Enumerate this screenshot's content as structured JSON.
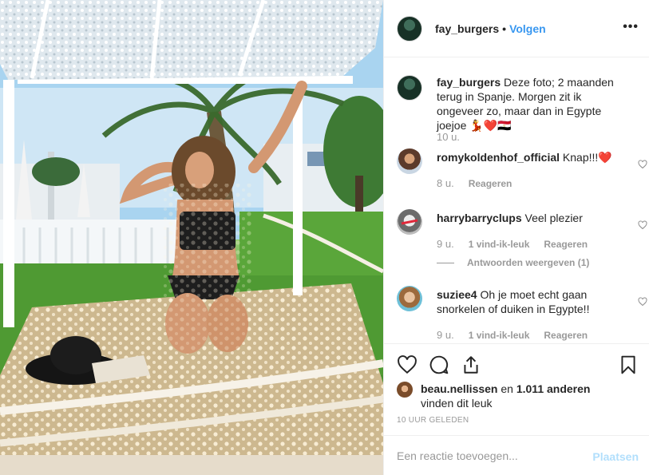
{
  "post": {
    "username": "fay_burgers",
    "follow_label": "Volgen",
    "more_label": "•••",
    "caption": {
      "username": "fay_burgers",
      "text": "Deze foto; 2 maanden terug in Spanje. Morgen zit ik ongeveer zo, maar dan in Egypte joejoe 💃❤️🇪🇬",
      "time": "10 u."
    },
    "comments": [
      {
        "username": "romykoldenhof_official",
        "text": "Knap!!!❤️",
        "time": "8 u.",
        "likes": "",
        "reply_label": "Reageren"
      },
      {
        "username": "harrybarryclups",
        "text": "Veel plezier",
        "time": "9 u.",
        "likes": "1 vind-ik-leuk",
        "reply_label": "Reageren",
        "view_replies": "Antwoorden weergeven (1)"
      },
      {
        "username": "suziee4",
        "text": "Oh je moet echt gaan snorkelen of duiken in Egypte!!",
        "time": "9 u.",
        "likes": "1 vind-ik-leuk",
        "reply_label": "Reageren"
      }
    ],
    "likes_line": {
      "user": "beau.nellissen",
      "connector": "en",
      "others": "1.011 anderen",
      "suffix": "vinden dit leuk"
    },
    "posted_ago": "10 UUR GELEDEN",
    "add_comment": {
      "placeholder": "Een reactie toevoegen...",
      "post_label": "Plaatsen"
    }
  },
  "colors": {
    "link_blue": "#3897f0",
    "post_disabled": "#b2dffc",
    "muted": "#999999",
    "text": "#262626",
    "border": "#efefef"
  },
  "icons": [
    "heart-icon",
    "comment-icon",
    "share-icon",
    "bookmark-icon",
    "more-options-icon"
  ]
}
